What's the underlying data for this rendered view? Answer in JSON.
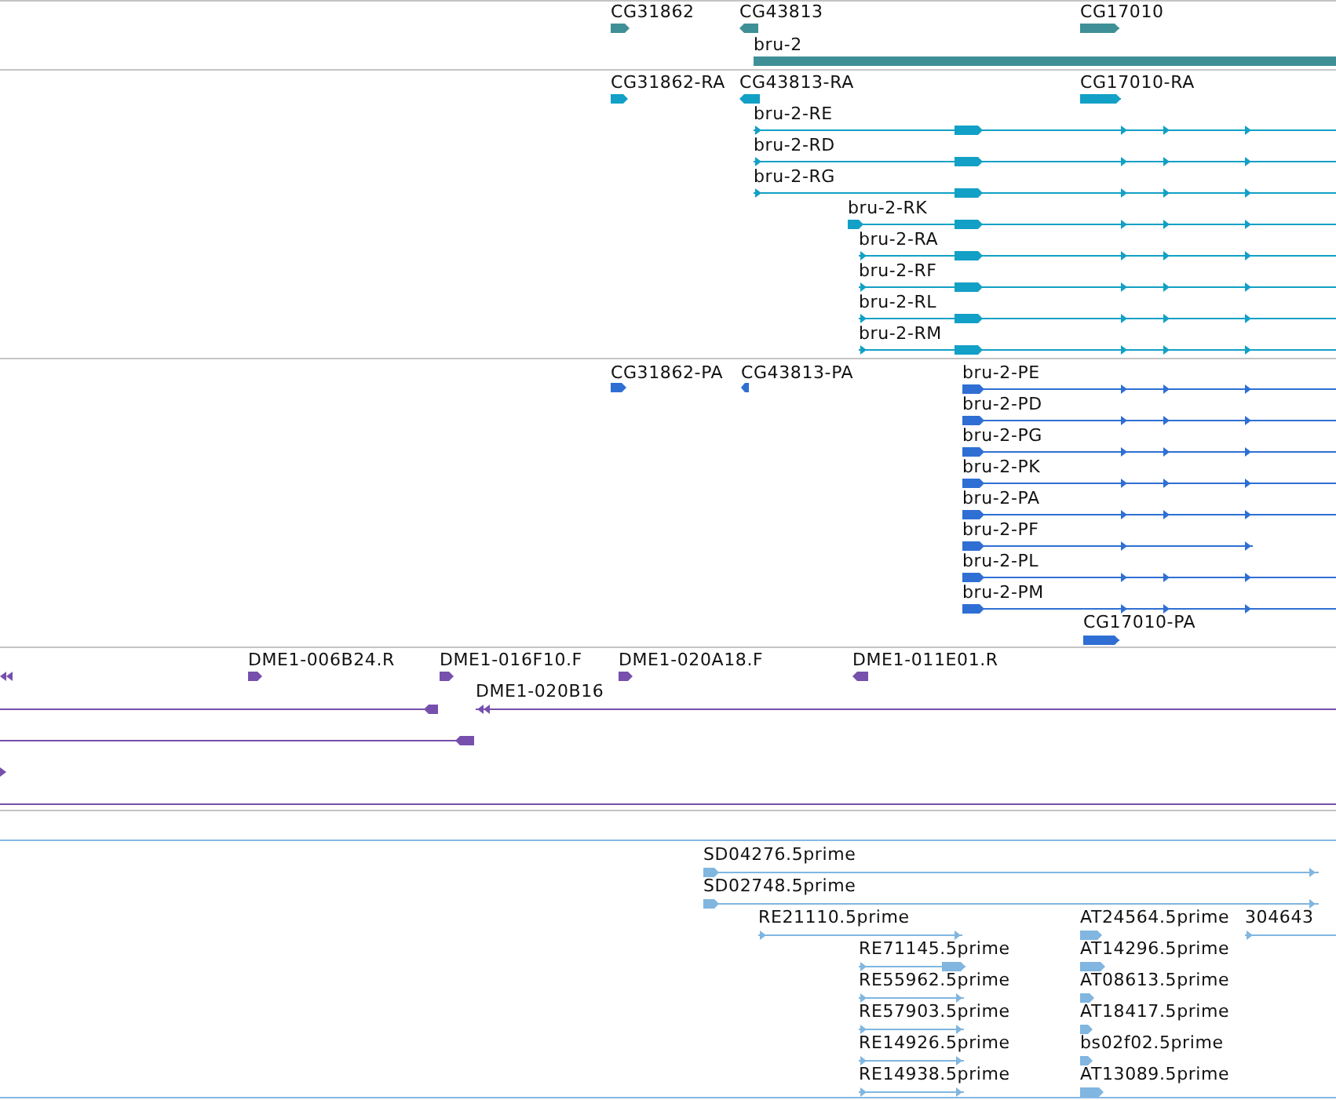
{
  "tracks": [
    {
      "kind": "gene",
      "color": "#3f8f96",
      "features": [
        {
          "label": "CG31862",
          "reverse": false
        },
        {
          "label": "CG43813",
          "reverse": true
        },
        {
          "label": "CG17010",
          "reverse": false
        },
        {
          "label": "bru-2"
        }
      ]
    },
    {
      "kind": "transcript",
      "color": "#12a0c6",
      "features": [
        {
          "label": "CG31862-RA",
          "reverse": false
        },
        {
          "label": "CG43813-RA",
          "reverse": true
        },
        {
          "label": "CG17010-RA",
          "reverse": false
        },
        {
          "label": "bru-2-RE",
          "reverse": false
        },
        {
          "label": "bru-2-RD",
          "reverse": false
        },
        {
          "label": "bru-2-RG",
          "reverse": false
        },
        {
          "label": "bru-2-RK",
          "reverse": false
        },
        {
          "label": "bru-2-RA",
          "reverse": false
        },
        {
          "label": "bru-2-RF",
          "reverse": false
        },
        {
          "label": "bru-2-RL",
          "reverse": false
        },
        {
          "label": "bru-2-RM",
          "reverse": false
        }
      ]
    },
    {
      "kind": "protein",
      "color": "#2f6fd4",
      "features": [
        {
          "label": "CG31862-PA",
          "reverse": false
        },
        {
          "label": "CG43813-PA",
          "reverse": true
        },
        {
          "label": "bru-2-PE",
          "reverse": false
        },
        {
          "label": "bru-2-PD",
          "reverse": false
        },
        {
          "label": "bru-2-PG",
          "reverse": false
        },
        {
          "label": "bru-2-PK",
          "reverse": false
        },
        {
          "label": "bru-2-PA",
          "reverse": false
        },
        {
          "label": "bru-2-PF",
          "reverse": false
        },
        {
          "label": "bru-2-PL",
          "reverse": false
        },
        {
          "label": "bru-2-PM",
          "reverse": false
        },
        {
          "label": "CG17010-PA",
          "reverse": false
        }
      ]
    },
    {
      "kind": "clone",
      "color": "#7650ac",
      "features": [
        {
          "reverse": true
        },
        {
          "label": "DME1-006B24.R",
          "reverse": false
        },
        {
          "label": "DME1-016F10.F",
          "reverse": false
        },
        {
          "label": "DME1-020A18.F",
          "reverse": false
        },
        {
          "label": "DME1-011E01.R",
          "reverse": true
        },
        {
          "label": "DME1-020B16",
          "reverse": true
        },
        {
          "reverse": true
        },
        {
          "reverse": true
        },
        {
          "reverse": false
        }
      ]
    },
    {
      "kind": "est",
      "color": "#80b6e0",
      "features": [
        {
          "label": "SD04276.5prime",
          "reverse": false
        },
        {
          "label": "SD02748.5prime",
          "reverse": false
        },
        {
          "label": "RE21110.5prime",
          "reverse": false
        },
        {
          "label": "AT24564.5prime",
          "reverse": false
        },
        {
          "label": "304643",
          "reverse": false
        },
        {
          "label": "RE71145.5prime",
          "reverse": false
        },
        {
          "label": "AT14296.5prime",
          "reverse": false
        },
        {
          "label": "RE55962.5prime",
          "reverse": false
        },
        {
          "label": "AT08613.5prime",
          "reverse": false
        },
        {
          "label": "RE57903.5prime",
          "reverse": false
        },
        {
          "label": "AT18417.5prime",
          "reverse": false
        },
        {
          "label": "RE14926.5prime",
          "reverse": false
        },
        {
          "label": "bs02f02.5prime",
          "reverse": false
        },
        {
          "label": "RE14938.5prime",
          "reverse": false
        },
        {
          "label": "AT13089.5prime",
          "reverse": false
        }
      ]
    }
  ]
}
